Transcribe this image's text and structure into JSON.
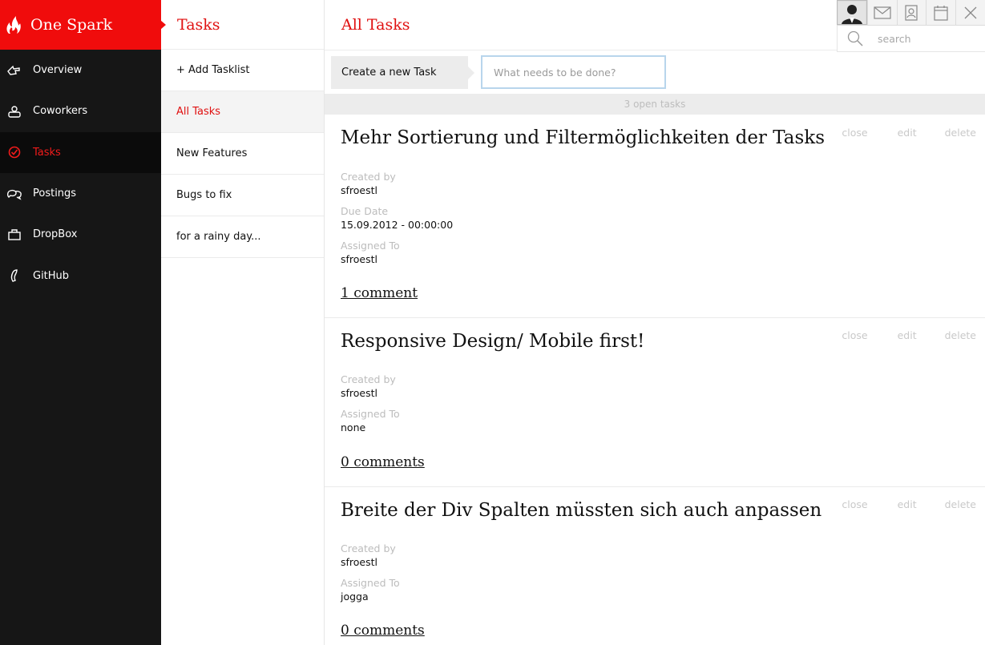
{
  "brand": {
    "name": "One Spark"
  },
  "nav": {
    "items": [
      {
        "label": "Overview",
        "icon": "hand-icon"
      },
      {
        "label": "Coworkers",
        "icon": "coworkers-icon"
      },
      {
        "label": "Tasks",
        "icon": "check-circle-icon",
        "active": true
      },
      {
        "label": "Postings",
        "icon": "chat-bubbles-icon"
      },
      {
        "label": "DropBox",
        "icon": "box-icon"
      },
      {
        "label": "GitHub",
        "icon": "github-icon"
      }
    ]
  },
  "tasklists": {
    "title": "Tasks",
    "add_label": "+ Add Tasklist",
    "items": [
      "All Tasks",
      "New Features",
      "Bugs to fix",
      "for a rainy day..."
    ]
  },
  "main": {
    "title": "All Tasks",
    "create_label": "Create a new Task",
    "create_placeholder": "What needs to be done?",
    "open_tasks": "3 open tasks"
  },
  "task_actions": {
    "close": "close",
    "edit": "edit",
    "delete": "delete"
  },
  "meta_labels": {
    "created_by": "Created by",
    "due_date": "Due Date",
    "assigned_to": "Assigned To"
  },
  "tasks": [
    {
      "title": "Mehr Sortierung und Filtermöglichkeiten der Tasks",
      "created_by": "sfroestl",
      "due_date": "15.09.2012 - 00:00:00",
      "assigned_to": "sfroestl",
      "comments": "1 comment"
    },
    {
      "title": "Responsive Design/ Mobile first!",
      "created_by": "sfroestl",
      "assigned_to": "none",
      "comments": "0 comments"
    },
    {
      "title": "Breite der Div Spalten müssten sich auch anpassen",
      "created_by": "sfroestl",
      "assigned_to": "jogga",
      "comments": "0 comments"
    }
  ],
  "topbar": {
    "search_placeholder": "search"
  },
  "colors": {
    "accent": "#f00c0c",
    "sidebar": "#161616"
  }
}
